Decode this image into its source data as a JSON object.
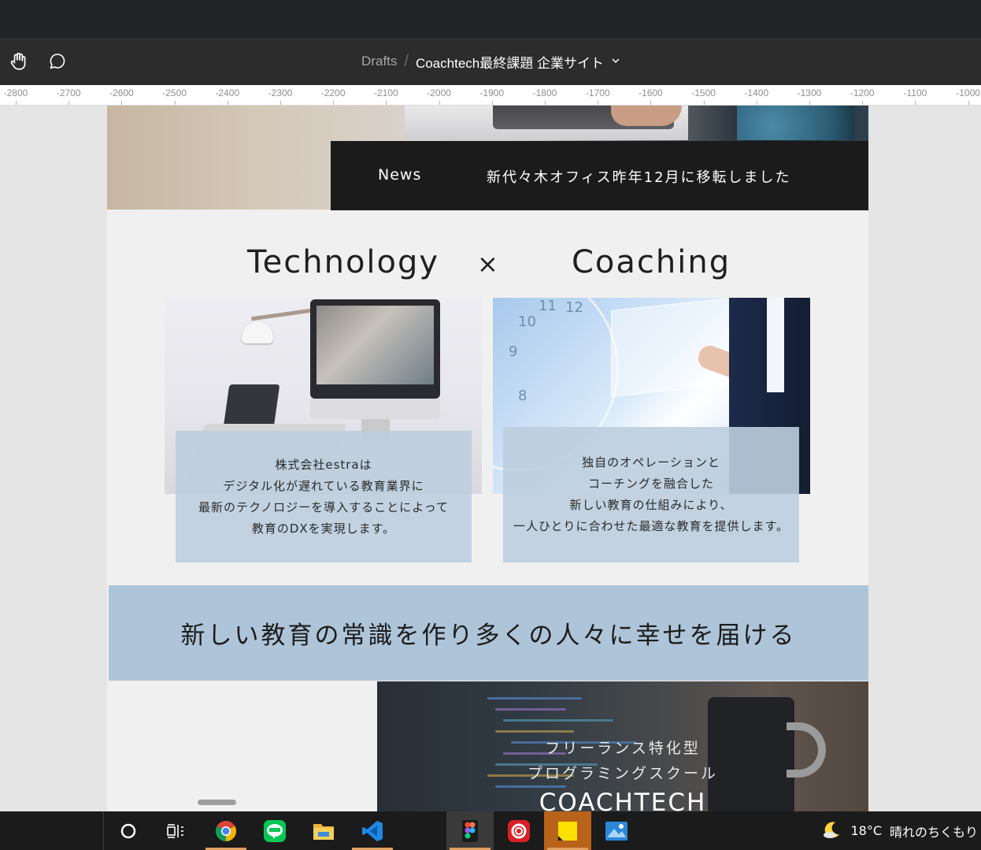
{
  "app": {
    "breadcrumb": {
      "drafts": "Drafts",
      "separator": "/",
      "file": "Coachtech最終課題 企業サイト",
      "chevron": "⌄"
    },
    "tools": [
      {
        "name": "hand-tool-icon"
      },
      {
        "name": "comment-icon"
      }
    ]
  },
  "ruler": {
    "ticks": [
      "-2800",
      "-2700",
      "-2600",
      "-2500",
      "-2400",
      "-2300",
      "-2200",
      "-2100",
      "-2000",
      "-1900",
      "-1800",
      "-1700",
      "-1600",
      "-1500",
      "-1400",
      "-1300",
      "-1200",
      "-1100",
      "-1000"
    ]
  },
  "design": {
    "news": {
      "label": "News",
      "text": "新代々木オフィス昨年12月に移転しました"
    },
    "headline": {
      "left": "Technology",
      "times": "×",
      "right": "Coaching"
    },
    "card_tech": {
      "lines": [
        "株式会社estraは",
        "デジタル化が遅れている教育業界に",
        "最新のテクノロジーを導入することによって",
        "教育のDXを実現します。"
      ]
    },
    "card_coach": {
      "lines": [
        "独自のオペレーションと",
        "コーチングを融合した",
        "新しい教育の仕組みにより、",
        "一人ひとりに合わせた最適な教育を提供します。"
      ]
    },
    "clock_numbers": [
      "11",
      "12",
      "10",
      "9",
      "8"
    ],
    "banner": {
      "text": "新しい教育の常識を作り多くの人々に幸せを届ける"
    },
    "school": {
      "line1": "フリーランス特化型",
      "line2": "プログラミングスクール",
      "line3": "COACHTECH"
    }
  },
  "taskbar": {
    "apps": [
      {
        "name": "cortana-icon"
      },
      {
        "name": "task-view-icon"
      },
      {
        "name": "chrome-icon"
      },
      {
        "name": "line-icon"
      },
      {
        "name": "file-explorer-icon"
      },
      {
        "name": "vscode-icon"
      },
      {
        "name": "figma-icon"
      },
      {
        "name": "creative-cloud-icon"
      },
      {
        "name": "sticky-notes-icon"
      },
      {
        "name": "photos-icon"
      }
    ],
    "weather": {
      "temp": "18°C",
      "condition": "晴れのちくもり"
    }
  },
  "colors": {
    "accent_orange": "#e0a060",
    "news_bg": "#1b1b1b",
    "banner_bg": "#aec4d8",
    "card_bg": "#bdcede"
  }
}
